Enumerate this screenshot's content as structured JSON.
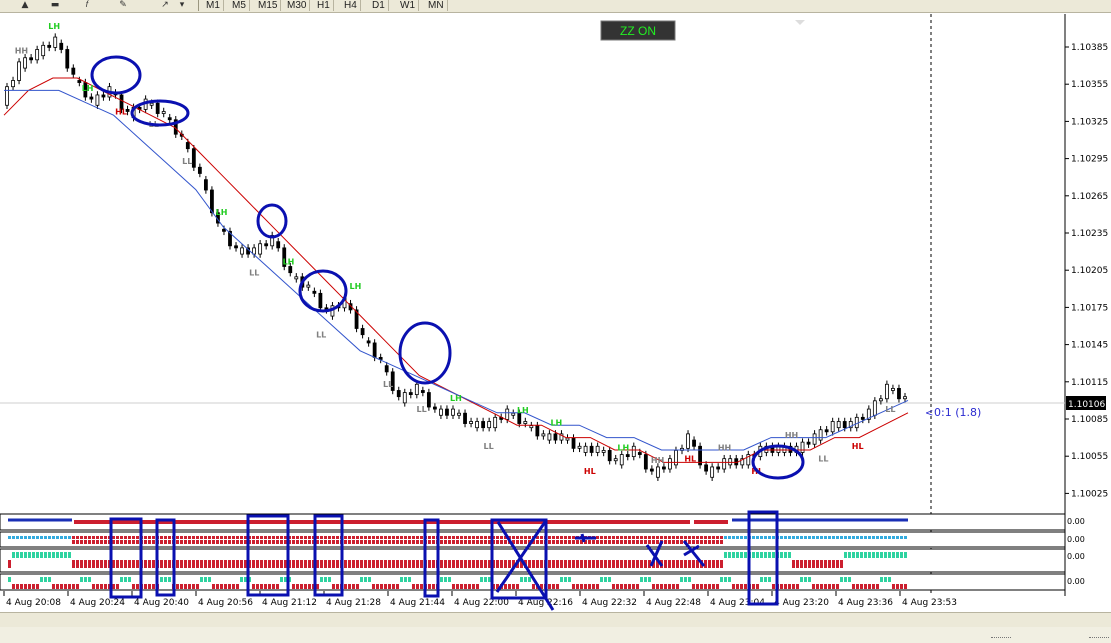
{
  "toolbar": {
    "icons": [
      "triangle-icon",
      "rectangle-icon",
      "fibonacci-icon",
      "label-icon",
      "arrow-icon"
    ],
    "timeframes": [
      "M1",
      "M5",
      "M15",
      "M30",
      "H1",
      "H4",
      "D1",
      "W1",
      "MN"
    ]
  },
  "zz_badge": "ZZ ON",
  "colors": {
    "bull": "#000000",
    "bear": "#000000",
    "ma_fast": "#cc0000",
    "ma_slow": "#3355cc",
    "annot": "#0a10b0",
    "label_green": "#22cc22",
    "label_red": "#cc0000",
    "label_gray": "#808080",
    "ind_red": "#cc1f2f",
    "ind_blue": "#1a2fb5",
    "ind_cyan": "#33aadd",
    "ind_teal": "#2ed3a0"
  },
  "price_axis": {
    "ticks": [
      "1.10385",
      "1.10355",
      "1.10325",
      "1.10295",
      "1.10265",
      "1.10235",
      "1.10205",
      "1.10175",
      "1.10145",
      "1.10115",
      "1.10085",
      "1.10055",
      "1.10025"
    ],
    "current": "1.10106",
    "label": "0:1 (1.8)"
  },
  "time_axis": [
    "4 Aug 20:08",
    "4 Aug 20:24",
    "4 Aug 20:40",
    "4 Aug 20:56",
    "4 Aug 21:12",
    "4 Aug 21:28",
    "4 Aug 21:44",
    "4 Aug 22:00",
    "4 Aug 22:16",
    "4 Aug 22:32",
    "4 Aug 22:48",
    "4 Aug 23:04",
    "4 Aug 23:20",
    "4 Aug 23:36",
    "4 Aug 23:53"
  ],
  "indicator_scales": [
    "0.00",
    "0.00",
    "0.00",
    "0.00"
  ],
  "chart_data": {
    "type": "line",
    "title": "",
    "ylim": [
      1.1001,
      1.1041
    ],
    "x": [
      "20:00",
      "20:04",
      "20:08",
      "20:12",
      "20:16",
      "20:20",
      "20:24",
      "20:28",
      "20:32",
      "20:36",
      "20:40",
      "20:44",
      "20:48",
      "20:52",
      "20:56",
      "21:00",
      "21:04",
      "21:08",
      "21:12",
      "21:16",
      "21:20",
      "21:24",
      "21:28",
      "21:32",
      "21:36",
      "21:40",
      "21:44",
      "21:48",
      "21:52",
      "21:56",
      "22:00",
      "22:04",
      "22:08",
      "22:12",
      "22:16",
      "22:20",
      "22:24",
      "22:28",
      "22:32",
      "22:36",
      "22:40",
      "22:44",
      "22:48",
      "22:52",
      "22:56",
      "23:00",
      "23:04",
      "23:08",
      "23:12",
      "23:16",
      "23:20",
      "23:24",
      "23:28",
      "23:32",
      "23:36",
      "23:40",
      "23:44",
      "23:48",
      "23:53"
    ],
    "series": [
      {
        "values": [
          1.1034,
          1.1037,
          1.1038,
          1.1039,
          1.1036,
          1.1034,
          1.1035,
          1.1033,
          1.1034,
          1.1033,
          1.1031,
          1.1028,
          1.1024,
          1.1022,
          1.1022,
          1.1023,
          1.102,
          1.1019,
          1.1017,
          1.1018,
          1.1015,
          1.1013,
          1.101,
          1.1011,
          1.1009,
          1.1009,
          1.1008,
          1.1008,
          1.1009,
          1.1008,
          1.1007,
          1.1007,
          1.1006,
          1.1006,
          1.1005,
          1.1006,
          1.1004,
          1.1005,
          1.1007,
          1.1004,
          1.1005,
          1.1005,
          1.1006,
          1.1006,
          1.1006,
          1.1007,
          1.1008,
          1.1008,
          1.1009,
          1.1011,
          1.101
        ]
      },
      {
        "name": "",
        "values": [
          1.1033,
          1.1035,
          1.1036,
          1.1036,
          1.1035,
          1.1034,
          1.1033,
          1.1032,
          1.103,
          1.1028,
          1.1026,
          1.1024,
          1.1022,
          1.102,
          1.1018,
          1.1016,
          1.1014,
          1.1012,
          1.1011,
          1.101,
          1.1009,
          1.1008,
          1.1008,
          1.1007,
          1.1007,
          1.1006,
          1.1006,
          1.1005,
          1.1005,
          1.1005,
          1.1005,
          1.1006,
          1.1006,
          1.1006,
          1.1007,
          1.1007,
          1.1008,
          1.1009
        ]
      },
      {
        "name": "",
        "values": [
          1.1035,
          1.1035,
          1.1035,
          1.1034,
          1.1033,
          1.1031,
          1.1029,
          1.1027,
          1.1024,
          1.1022,
          1.102,
          1.1018,
          1.1016,
          1.1014,
          1.1013,
          1.1012,
          1.1011,
          1.101,
          1.1009,
          1.1009,
          1.1008,
          1.1008,
          1.1007,
          1.1007,
          1.1006,
          1.1006,
          1.1006,
          1.1006,
          1.1007,
          1.1007,
          1.1007,
          1.1008,
          1.1009,
          1.101
        ]
      }
    ],
    "swing_labels": [
      {
        "text": "HH",
        "color": "gray"
      },
      {
        "text": "LH",
        "color": "green"
      },
      {
        "text": "LH",
        "color": "green"
      },
      {
        "text": "HL",
        "color": "red"
      },
      {
        "text": "LL",
        "color": "gray"
      },
      {
        "text": "LL",
        "color": "gray"
      },
      {
        "text": "LH",
        "color": "green"
      },
      {
        "text": "LL",
        "color": "gray"
      },
      {
        "text": "LH",
        "color": "green"
      },
      {
        "text": "LL",
        "color": "gray"
      },
      {
        "text": "LH",
        "color": "green"
      },
      {
        "text": "LL",
        "color": "gray"
      },
      {
        "text": "LL",
        "color": "gray"
      },
      {
        "text": "LH",
        "color": "green"
      },
      {
        "text": "LL",
        "color": "gray"
      },
      {
        "text": "LH",
        "color": "green"
      },
      {
        "text": "LH",
        "color": "green"
      },
      {
        "text": "HL",
        "color": "red"
      },
      {
        "text": "LH",
        "color": "green"
      },
      {
        "text": "HH",
        "color": "gray"
      },
      {
        "text": "HL",
        "color": "red"
      },
      {
        "text": "HH",
        "color": "gray"
      },
      {
        "text": "HL",
        "color": "red"
      },
      {
        "text": "HH",
        "color": "gray"
      },
      {
        "text": "LL",
        "color": "gray"
      },
      {
        "text": "HL",
        "color": "red"
      },
      {
        "text": "LL",
        "color": "gray"
      }
    ]
  }
}
